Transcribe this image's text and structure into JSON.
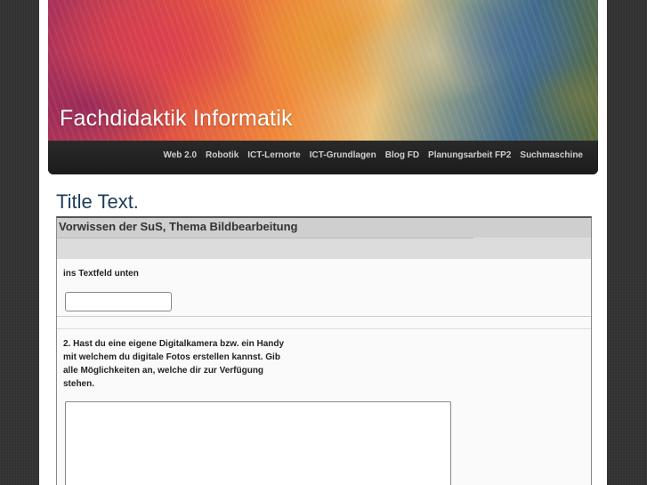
{
  "header": {
    "site_title": "Fachdidaktik Informatik"
  },
  "nav": {
    "items": [
      {
        "label": "Web 2.0"
      },
      {
        "label": "Robotik"
      },
      {
        "label": "ICT-Lernorte"
      },
      {
        "label": "ICT-Grundlagen"
      },
      {
        "label": "Blog FD"
      },
      {
        "label": "Planungsarbeit FP2"
      },
      {
        "label": "Suchmaschine"
      }
    ]
  },
  "content": {
    "title": "Title Text."
  },
  "form": {
    "title": "Vorwissen der SuS, Thema Bildbearbeitung",
    "q1_label": "ins Textfeld unten",
    "q1_value": "",
    "q2_label": "2. Hast du eine eigene Digitalkamera bzw. ein Handy mit welchem du digitale Fotos erstellen kannst. Gib alle Möglichkeiten an, welche dir zur Verfügung stehen.",
    "q2_value": ""
  }
}
